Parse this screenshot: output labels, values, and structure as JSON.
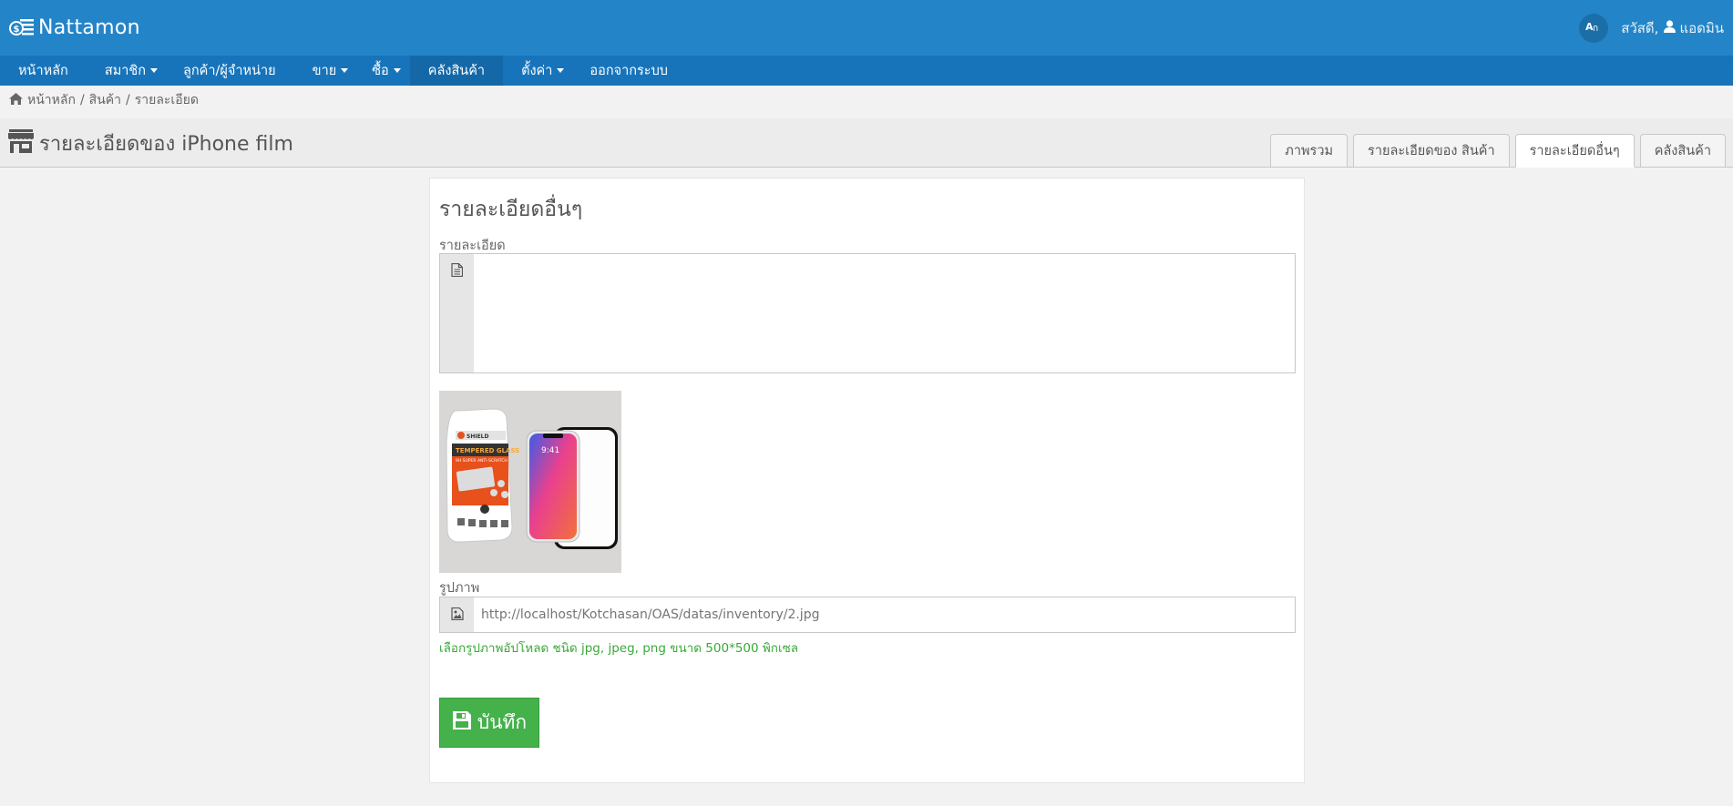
{
  "header": {
    "brand": "Nattamon",
    "greeting": "สวัสดี,",
    "username": "แอดมิน"
  },
  "menu": [
    {
      "label": "หน้าหลัก"
    },
    {
      "label": "สมาชิก"
    },
    {
      "label": "ลูกค้า/ผู้จำหน่าย"
    },
    {
      "label": "ขาย"
    },
    {
      "label": "ซื้อ"
    },
    {
      "label": "คลังสินค้า"
    },
    {
      "label": "ตั้งค่า"
    },
    {
      "label": "ออกจากระบบ"
    }
  ],
  "breadcrumb": {
    "home": "หน้าหลัก",
    "sep1": "/",
    "products": "สินค้า",
    "sep2": "/",
    "current": "รายละเอียด"
  },
  "page": {
    "title": "รายละเอียดของ iPhone film"
  },
  "tabs": [
    {
      "label": "ภาพรวม"
    },
    {
      "label": "รายละเอียดของ สินค้า"
    },
    {
      "label": "รายละเอียดอื่นๆ"
    },
    {
      "label": "คลังสินค้า"
    }
  ],
  "form": {
    "section_title": "รายละเอียดอื่นๆ",
    "detail_label": "รายละเอียด",
    "detail_value": "",
    "image_label": "รูปภาพ",
    "image_placeholder": "http://localhost/Kotchasan/OAS/datas/inventory/2.jpg",
    "image_help": "เลือกรูปภาพอัปโหลด ชนิด jpg, jpeg, png ขนาด 500*500 พิกเซล",
    "save_label": "บันทึก"
  },
  "product_image": {
    "brand_text": "SHIELD",
    "line1": "TEMPERED GLASS",
    "line2": "9H SUPER ANTI-SCRATCH",
    "phone_time": "9:41"
  },
  "colors": {
    "header_bg": "#2385c8",
    "menu_bg": "#1774bb",
    "save_button": "#44b14a",
    "help_text": "#3aa838"
  }
}
